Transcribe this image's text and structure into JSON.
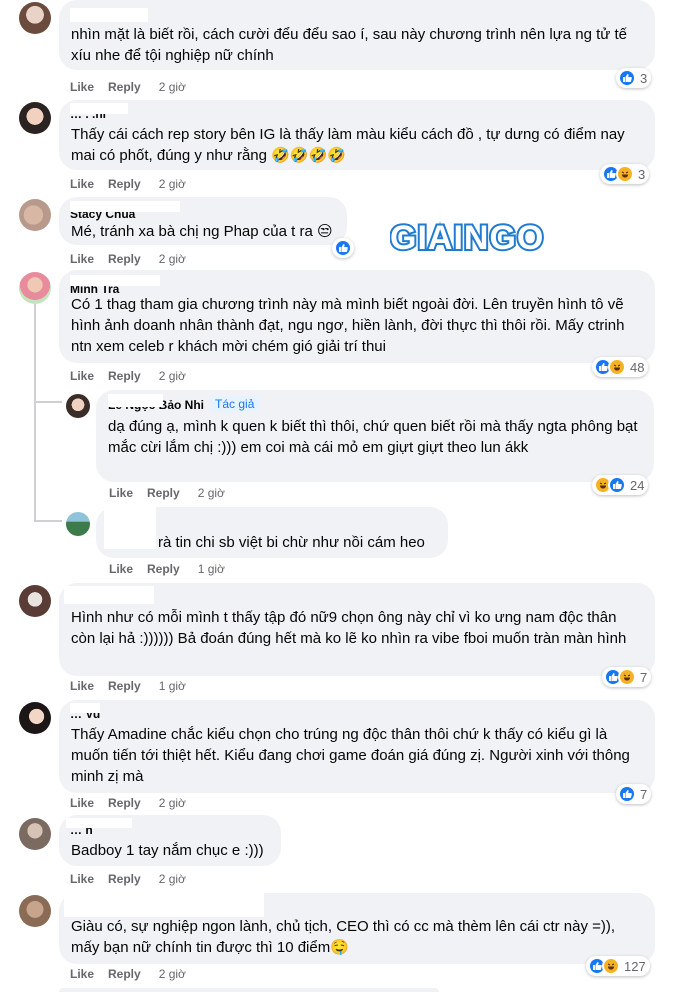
{
  "colors": {
    "like": "#1877f2",
    "haha": "#f7b125",
    "bubble": "#f0f2f5",
    "meta": "#65676b",
    "logo": "#1e7bd1"
  },
  "labels": {
    "like": "Like",
    "reply": "Reply"
  },
  "watermark": "GIAINGO",
  "comments": [
    {
      "author": "",
      "text": "nhìn mặt là biết rồi, cách cười đểu đểu sao í, sau này chương trình nên lựa ng tử tế xíu nhe để tội nghiệp nữ chính",
      "time": "2 giờ",
      "reactions": [
        "like-icon"
      ],
      "count": "3"
    },
    {
      "author": "…  . .ni",
      "text": "Thấy cái cách rep story bên IG là thấy làm màu kiểu cách đồ , tự dưng có điểm nay mai có phốt, đúng y như rằng 🤣🤣🤣🤣",
      "time": "2 giờ",
      "reactions": [
        "like-icon",
        "haha-icon"
      ],
      "count": "3"
    },
    {
      "author": "Stacy Chua",
      "text": "Mé, tránh xa bà chị ng Phap của t ra 😒",
      "time": "2 giờ",
      "reactions": [
        "like-icon"
      ],
      "count": ""
    },
    {
      "author": "Minh Tra",
      "text": "Có 1 thag tham gia chương trình này mà mình biết ngoài đời. Lên truyền hình tô vẽ hình ảnh doanh nhân thành đạt, ngu ngơ, hiền lành, đời thực thì thôi rồi. Mấy ctrinh ntn xem celeb r khách mời chém gió giải trí thui",
      "time": "2 giờ",
      "reactions": [
        "like-icon",
        "haha-icon"
      ],
      "count": "48"
    },
    {
      "author": "Lê Ngọc Bảo Nhi",
      "badge": "Tác giả",
      "text": "dạ đúng ạ, mình k quen k biết thì thôi, chứ quen biết rồi mà thấy ngta phông bạt mắc cừi lắm chị :))) em coi mà cái mỏ em giựt giựt theo lun ákk",
      "time": "2 giờ",
      "reactions": [
        "haha-icon",
        "like-icon"
      ],
      "count": "24"
    },
    {
      "author": "",
      "text": "rà tin chi sb việt bi chừ như nồi cám heo",
      "time": "1 giờ",
      "reactions": [],
      "count": ""
    },
    {
      "author": "",
      "text": "Hình như có mỗi mình t thấy tập đó nữ9 chọn ông này chỉ vì ko ưng nam độc thân còn lại hả :)))))) Bả đoán đúng hết mà ko lẽ ko nhìn ra vibe fboi muốn tràn màn hình",
      "time": "1 giờ",
      "reactions": [
        "like-icon",
        "haha-icon"
      ],
      "count": "7"
    },
    {
      "author": "… Vu",
      "text": "Thấy Amadine chắc kiểu chọn cho trúng ng độc thân thôi chứ k thấy có kiểu gì là muốn tiến tới thiệt hết. Kiểu đang chơi game đoán giá đúng zị. Người xinh với thông minh zị mà",
      "time": "2 giờ",
      "reactions": [
        "like-icon"
      ],
      "count": "7"
    },
    {
      "author": "…  n",
      "text": "Badboy 1 tay nắm chục e :)))",
      "time": "2 giờ",
      "reactions": [],
      "count": ""
    },
    {
      "author": "",
      "text": "Giàu có, sự nghiệp ngon lành, chủ tịch, CEO thì có cc mà thèm lên cái ctr này =)), mấy bạn nữ chính tin được thì 10 điểm🤤",
      "time": "2 giờ",
      "reactions": [
        "like-icon",
        "haha-icon"
      ],
      "count": "127"
    }
  ]
}
